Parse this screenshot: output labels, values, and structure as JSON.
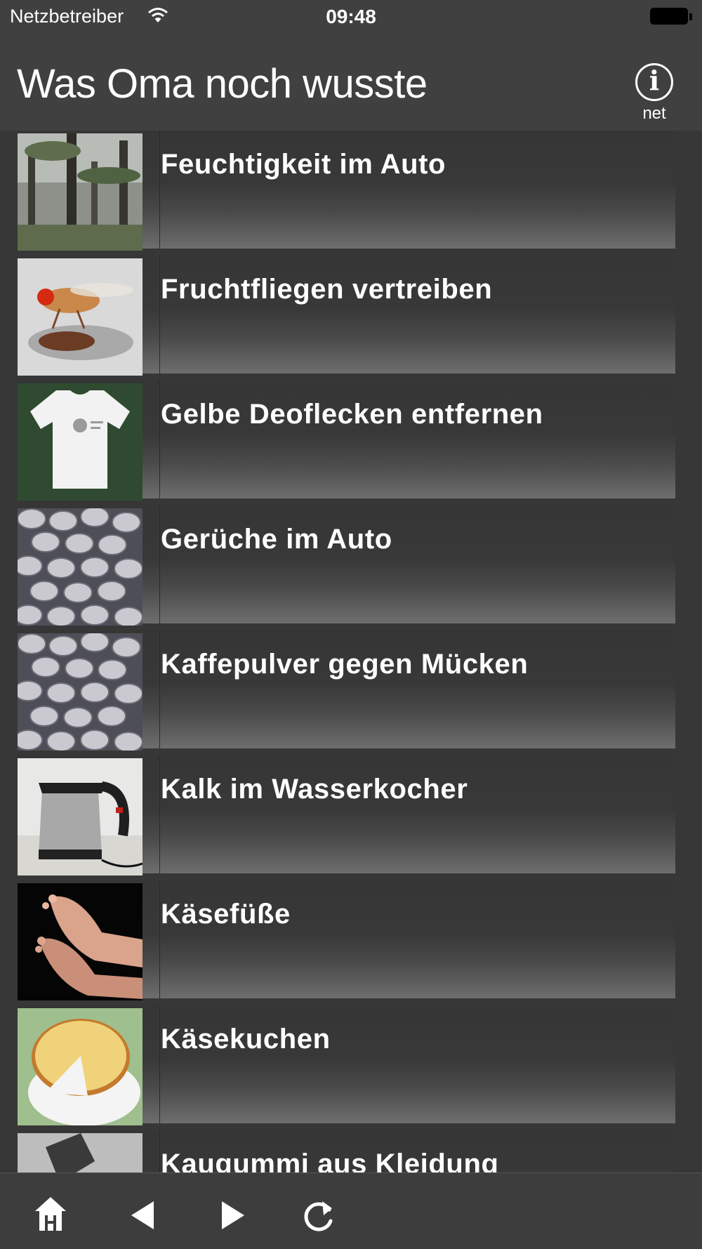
{
  "status_bar": {
    "carrier": "Netzbetreiber",
    "time": "09:48"
  },
  "nav": {
    "title": "Was Oma noch wusste",
    "info_caption": "net"
  },
  "items": [
    {
      "title": "Feuchtigkeit im Auto",
      "image": "forest"
    },
    {
      "title": "Fruchtfliegen vertreiben",
      "image": "fly"
    },
    {
      "title": "Gelbe Deoflecken entfernen",
      "image": "tshirt"
    },
    {
      "title": "Gerüche im Auto",
      "image": "coffee"
    },
    {
      "title": "Kaffepulver gegen Mücken",
      "image": "coffee"
    },
    {
      "title": "Kalk im Wasserkocher",
      "image": "kettle"
    },
    {
      "title": "Käsefüße",
      "image": "feet"
    },
    {
      "title": "Käsekuchen",
      "image": "cake"
    },
    {
      "title": "Kaugummi aus Kleidung",
      "image": "gum"
    }
  ],
  "toolbar": {
    "icons": [
      "home-icon",
      "back-icon",
      "forward-icon",
      "reload-icon"
    ]
  }
}
